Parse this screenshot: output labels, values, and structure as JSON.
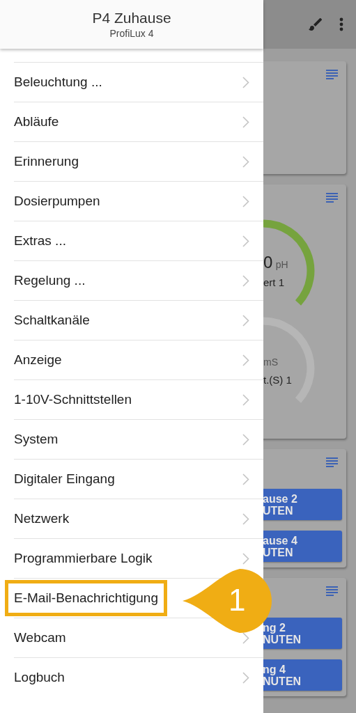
{
  "app_bar": {
    "title": "P4 Zuhause",
    "subtitle": "ProfiLux 4"
  },
  "menu": [
    {
      "label": "Beleuchtung ...",
      "highlighted": false
    },
    {
      "label": "Abläufe",
      "highlighted": false
    },
    {
      "label": "Erinnerung",
      "highlighted": false
    },
    {
      "label": "Dosierpumpen",
      "highlighted": false
    },
    {
      "label": "Extras ...",
      "highlighted": false
    },
    {
      "label": "Regelung ...",
      "highlighted": false
    },
    {
      "label": "Schaltkanäle",
      "highlighted": false
    },
    {
      "label": "Anzeige",
      "highlighted": false
    },
    {
      "label": "1-10V-Schnittstellen",
      "highlighted": false
    },
    {
      "label": "System",
      "highlighted": false
    },
    {
      "label": "Digitaler Eingang",
      "highlighted": false
    },
    {
      "label": "Netzwerk",
      "highlighted": false
    },
    {
      "label": "Programmierbare Logik",
      "highlighted": false
    },
    {
      "label": "E-Mail-Benachrichtigung",
      "highlighted": true
    },
    {
      "label": "Webcam",
      "highlighted": false
    },
    {
      "label": "Logbuch",
      "highlighted": false
    }
  ],
  "callout": {
    "number": "1"
  },
  "background_cards": [
    {
      "kind": "empty"
    },
    {
      "kind": "gauges",
      "gauges": [
        {
          "value": "0",
          "unit": "pH",
          "label": "ert 1",
          "active": true
        },
        {
          "unit": "mS",
          "label": "t.(S) 1",
          "active": false
        }
      ]
    },
    {
      "kind": "buttons",
      "buttons": [
        {
          "line1": "ause 2",
          "line2": "UTEN"
        },
        {
          "line1": "ause 4",
          "line2": "UTEN"
        }
      ]
    },
    {
      "kind": "buttons",
      "buttons": [
        {
          "line1": "ng 2",
          "line2": "NUTEN"
        },
        {
          "line1": "ng 4",
          "line2": "NUTEN"
        }
      ]
    }
  ]
}
